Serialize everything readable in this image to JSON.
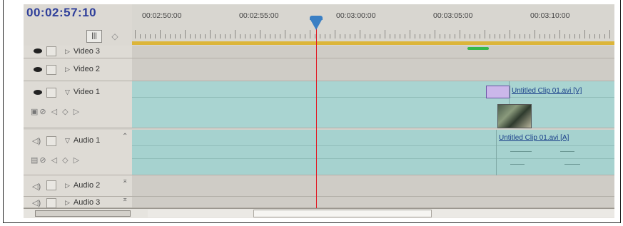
{
  "header": {
    "timecode": "00:02:57:10"
  },
  "ruler": {
    "labels": [
      "00:02:50:00",
      "00:02:55:00",
      "00:03:00:00",
      "00:03:05:00",
      "00:03:10:00"
    ]
  },
  "tracks": {
    "video3": {
      "label": "Video 3"
    },
    "video2": {
      "label": "Video 2"
    },
    "video1": {
      "label": "Video 1",
      "clip_name": "Untitled Clip 01.avi [V]"
    },
    "audio1": {
      "label": "Audio 1",
      "clip_name": "Untitled Clip 01.avi [A]"
    },
    "audio2": {
      "label": "Audio 2"
    },
    "audio3": {
      "label": "Audio 3"
    }
  },
  "icons": {
    "eye": "eye-icon",
    "speaker": "speaker-icon",
    "lock": "lock-icon",
    "snap": "snap-icon",
    "marker": "marker-icon",
    "playhead": "playhead-icon"
  },
  "colors": {
    "timecode": "#2f3f9a",
    "playhead": "#e0202a",
    "playhead_handle": "#3a7fc4",
    "video_track": "#a9d4d1",
    "audio_track": "#a6d2cf",
    "work_area_bar": "#dcb53a"
  }
}
